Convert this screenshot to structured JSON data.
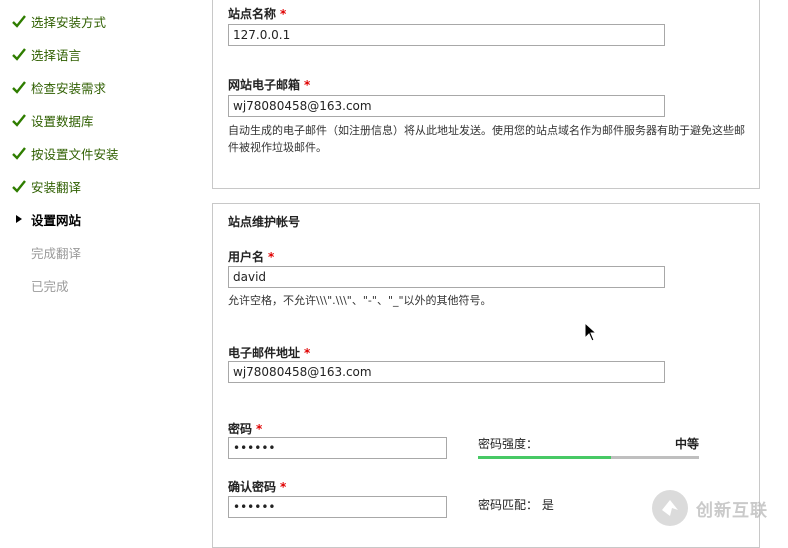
{
  "sidebar": {
    "steps": [
      {
        "label": "选择安装方式",
        "state": "done"
      },
      {
        "label": "选择语言",
        "state": "done"
      },
      {
        "label": "检查安装需求",
        "state": "done"
      },
      {
        "label": "设置数据库",
        "state": "done"
      },
      {
        "label": "按设置文件安装",
        "state": "done"
      },
      {
        "label": "安装翻译",
        "state": "done"
      },
      {
        "label": "设置网站",
        "state": "current"
      },
      {
        "label": "完成翻译",
        "state": "todo"
      },
      {
        "label": "已完成",
        "state": "todo"
      }
    ]
  },
  "site": {
    "name_label": "站点名称",
    "name_value": "127.0.0.1",
    "email_label": "网站电子邮箱",
    "email_value": "wj78080458@163.com",
    "email_desc": "自动生成的电子邮件（如注册信息）将从此地址发送。使用您的站点域名作为邮件服务器有助于避免这些邮件被视作垃圾邮件。"
  },
  "admin": {
    "legend": "站点维护帐号",
    "username_label": "用户名",
    "username_value": "david",
    "username_desc": "允许空格，不允许\\\\\\\".\\\\\\\"、\"-\"、\"_\"以外的其他符号。",
    "email_label": "电子邮件地址",
    "email_value": "wj78080458@163.com",
    "password_label": "密码",
    "password_value": "••••••",
    "confirm_label": "确认密码",
    "confirm_value": "••••••",
    "strength_label": "密码强度：",
    "strength_value": "中等",
    "strength_fraction": 0.6,
    "match_label": "密码匹配：",
    "match_value": "是"
  },
  "required_mark": "*",
  "watermark": {
    "text": "创新互联"
  },
  "colors": {
    "done": "#2f5f00",
    "todo": "#9a9a9a",
    "required": "#e00000",
    "strength_fill": "#47c965"
  }
}
